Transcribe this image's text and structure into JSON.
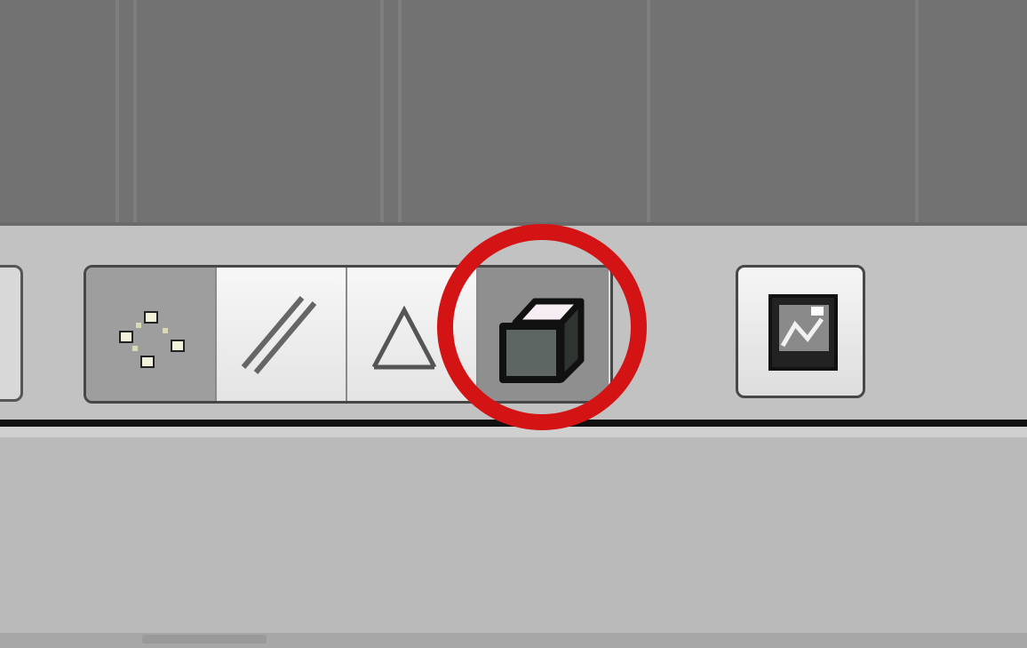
{
  "viewport": {
    "background": "#727272"
  },
  "header": {
    "mode_buttons": [
      {
        "name": "vertex-select-mode",
        "icon": "vertex-select-icon",
        "active": true
      },
      {
        "name": "edge-select-mode",
        "icon": "edge-select-icon",
        "active": false
      },
      {
        "name": "face-select-mode",
        "icon": "face-select-icon",
        "active": false
      },
      {
        "name": "occlude-geometry-toggle",
        "icon": "solid-cube-icon",
        "active": true
      }
    ],
    "render_button": {
      "icon": "render-image-icon"
    }
  },
  "annotation": {
    "shape": "circle",
    "color": "#d41414",
    "target": "occlude-geometry-toggle"
  }
}
